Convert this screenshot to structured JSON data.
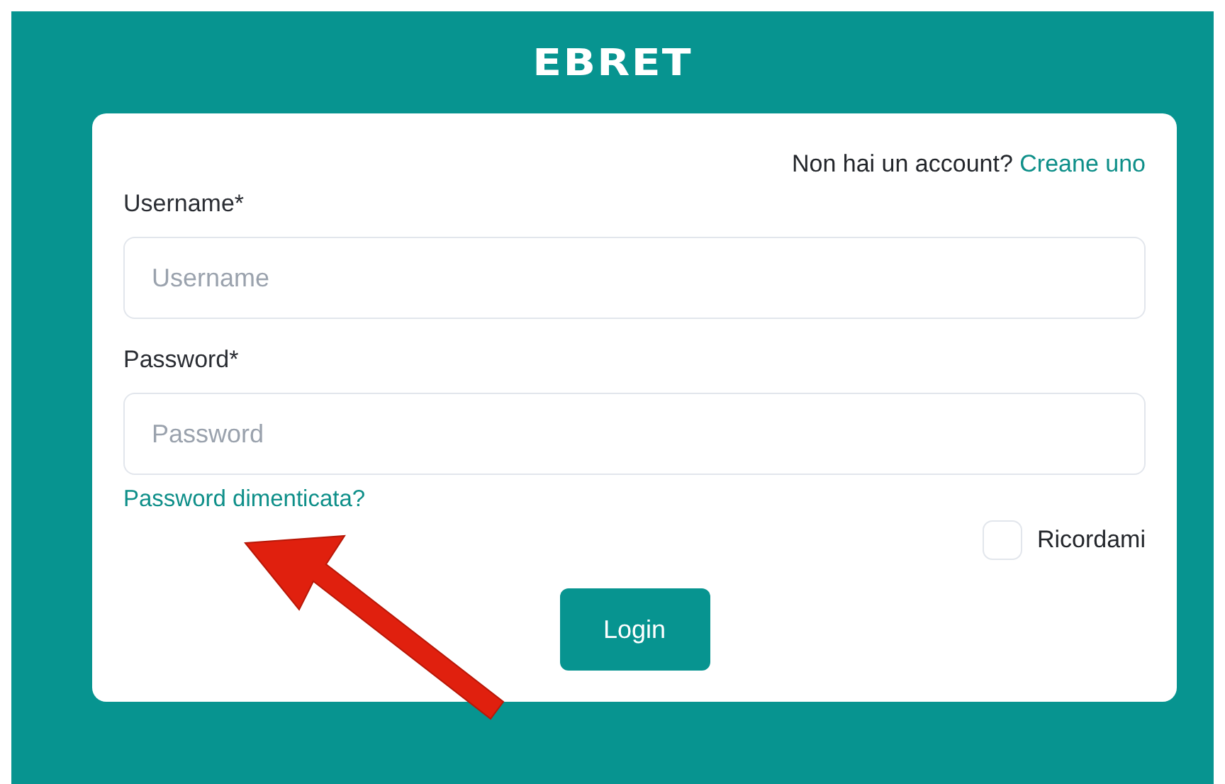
{
  "logo": "EBRET",
  "signup": {
    "prompt": "Non hai un account?",
    "link": "Creane uno"
  },
  "fields": [
    {
      "label": "Username*",
      "placeholder": "Username"
    },
    {
      "label": "Password*",
      "placeholder": "Password"
    }
  ],
  "forgot_link": "Password dimenticata?",
  "remember": {
    "label": "Ricordami",
    "checked": false
  },
  "login_button": "Login"
}
